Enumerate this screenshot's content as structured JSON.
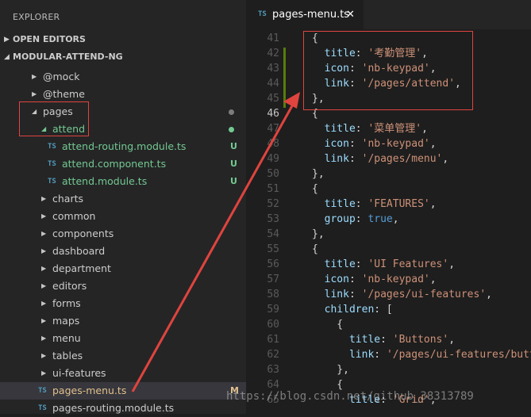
{
  "sidebar": {
    "title": "EXPLORER",
    "open_editors": "OPEN EDITORS",
    "project": "MODULAR-ATTEND-NG",
    "items": [
      {
        "label": "@mock",
        "type": "folder",
        "depth": 1
      },
      {
        "label": "@theme",
        "type": "folder",
        "depth": 1
      },
      {
        "label": "pages",
        "type": "folder-open",
        "depth": 1
      },
      {
        "label": "attend",
        "type": "folder-open",
        "depth": 2
      },
      {
        "label": "attend-routing.module.ts",
        "type": "file",
        "depth": 3,
        "status": "U"
      },
      {
        "label": "attend.component.ts",
        "type": "file",
        "depth": 3,
        "status": "U"
      },
      {
        "label": "attend.module.ts",
        "type": "file",
        "depth": 3,
        "status": "U"
      },
      {
        "label": "charts",
        "type": "folder",
        "depth": 2
      },
      {
        "label": "common",
        "type": "folder",
        "depth": 2
      },
      {
        "label": "components",
        "type": "folder",
        "depth": 2
      },
      {
        "label": "dashboard",
        "type": "folder",
        "depth": 2
      },
      {
        "label": "department",
        "type": "folder",
        "depth": 2
      },
      {
        "label": "editors",
        "type": "folder",
        "depth": 2
      },
      {
        "label": "forms",
        "type": "folder",
        "depth": 2
      },
      {
        "label": "maps",
        "type": "folder",
        "depth": 2
      },
      {
        "label": "menu",
        "type": "folder",
        "depth": 2
      },
      {
        "label": "tables",
        "type": "folder",
        "depth": 2
      },
      {
        "label": "ui-features",
        "type": "folder",
        "depth": 2
      },
      {
        "label": "pages-menu.ts",
        "type": "file",
        "depth": 2,
        "status": "M"
      },
      {
        "label": "pages-routing.module.ts",
        "type": "file",
        "depth": 2
      }
    ],
    "file_icon_text": "TS"
  },
  "tab": {
    "icon_text": "TS",
    "label": "pages-menu.ts",
    "close": "✕"
  },
  "code": {
    "lines": [
      {
        "n": "41",
        "t": "{"
      },
      {
        "n": "42",
        "t": "  title: '考勤管理',"
      },
      {
        "n": "43",
        "t": "  icon: 'nb-keypad',"
      },
      {
        "n": "44",
        "t": "  link: '/pages/attend',"
      },
      {
        "n": "45",
        "t": "},"
      },
      {
        "n": "46",
        "t": "{"
      },
      {
        "n": "47",
        "t": "  title: '菜单管理',"
      },
      {
        "n": "48",
        "t": "  icon: 'nb-keypad',"
      },
      {
        "n": "49",
        "t": "  link: '/pages/menu',"
      },
      {
        "n": "50",
        "t": "},"
      },
      {
        "n": "51",
        "t": "{"
      },
      {
        "n": "52",
        "t": "  title: 'FEATURES',"
      },
      {
        "n": "53",
        "t": "  group: true,"
      },
      {
        "n": "54",
        "t": "},"
      },
      {
        "n": "55",
        "t": "{"
      },
      {
        "n": "56",
        "t": "  title: 'UI Features',"
      },
      {
        "n": "57",
        "t": "  icon: 'nb-keypad',"
      },
      {
        "n": "58",
        "t": "  link: '/pages/ui-features',"
      },
      {
        "n": "59",
        "t": "  children: ["
      },
      {
        "n": "60",
        "t": "    {"
      },
      {
        "n": "61",
        "t": "      title: 'Buttons',"
      },
      {
        "n": "62",
        "t": "      link: '/pages/ui-features/butt"
      },
      {
        "n": "63",
        "t": "    },"
      },
      {
        "n": "64",
        "t": "    {"
      },
      {
        "n": "65",
        "t": "      title: 'Grid',"
      }
    ]
  },
  "watermark": "https://blog.csdn.net/github_38313789",
  "colors": {
    "annotation": "#e0443e",
    "untracked": "#73c991",
    "modified": "#e2c08d",
    "ts_icon": "#519aba"
  }
}
